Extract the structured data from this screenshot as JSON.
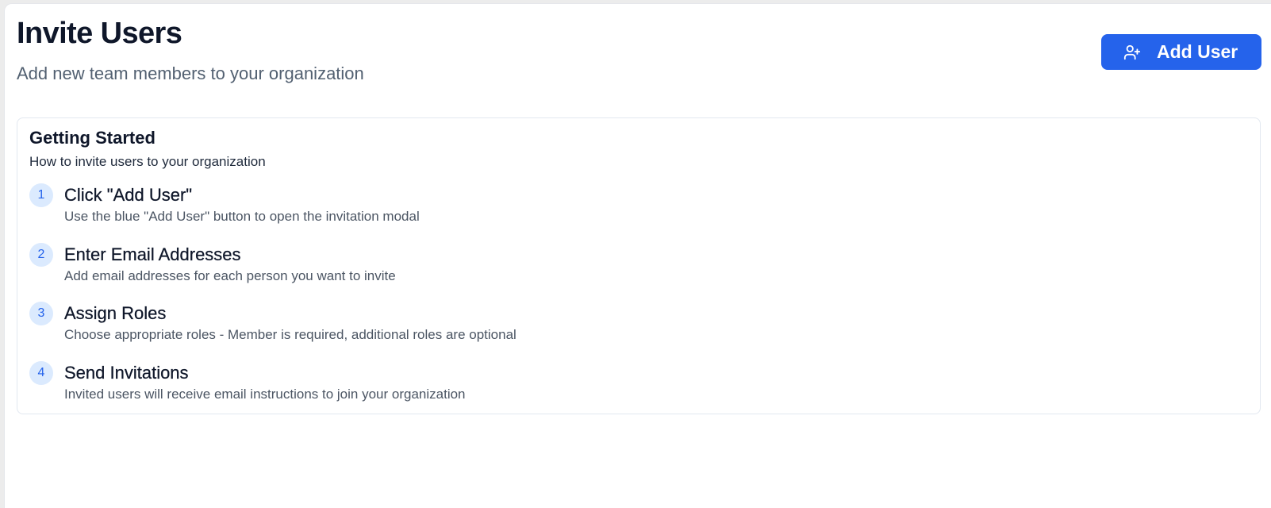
{
  "header": {
    "title": "Invite Users",
    "subtitle": "Add new team members to your organization",
    "add_user_button": {
      "label": "Add User",
      "icon": "user-plus-icon"
    }
  },
  "getting_started": {
    "title": "Getting Started",
    "description": "How to invite users to your organization",
    "steps": [
      {
        "number": "1",
        "title": "Click \"Add User\"",
        "description": "Use the blue \"Add User\" button to open the invitation modal"
      },
      {
        "number": "2",
        "title": "Enter Email Addresses",
        "description": "Add email addresses for each person you want to invite"
      },
      {
        "number": "3",
        "title": "Assign Roles",
        "description": "Choose appropriate roles - Member is required, additional roles are optional"
      },
      {
        "number": "4",
        "title": "Send Invitations",
        "description": "Invited users will receive email instructions to join your organization"
      }
    ]
  },
  "colors": {
    "primary": "#2563eb",
    "step_badge_bg": "#dbeafe",
    "heading": "#0f172a",
    "muted_text": "#4b5563"
  }
}
